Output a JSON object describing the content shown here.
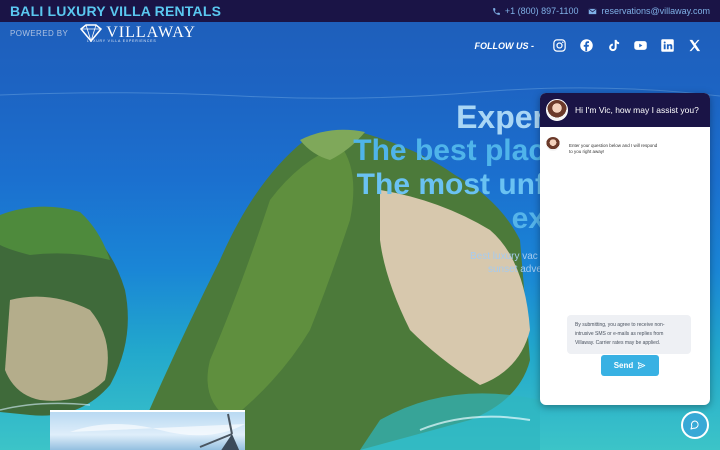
{
  "topbar": {
    "brand": "BALI LUXURY VILLA RENTALS",
    "phone": "+1 (800) 897-1100",
    "email": "reservations@villaway.com"
  },
  "powered": {
    "label": "POWERED BY",
    "logo_text": "VILLAWAY",
    "logo_tagline": "LUXURY VILLA EXPERIENCES"
  },
  "social": {
    "label": "FOLLOW US -",
    "icons": [
      "instagram-icon",
      "facebook-icon",
      "tiktok-icon",
      "youtube-icon",
      "linkedin-icon",
      "x-icon"
    ]
  },
  "hero": {
    "line1": "Exper",
    "line2": "The best plac",
    "line3": "The most unf",
    "line4": "ex",
    "sub1": "Best luxury vac",
    "sub2": "sunset adve"
  },
  "chat": {
    "greeting": "Hi I'm Vic, how may I assist you?",
    "message": "Enter your question below and I will respond to you right away!",
    "consent": "By submitting, you agree to receive non-intrusive SMS or e-mails as replies from Villaway. Carrier rates may be applied.",
    "send_label": "Send"
  },
  "colors": {
    "topbar": "#1a1446",
    "accent": "#38b1e3",
    "brand_text": "#5ac8f0"
  }
}
